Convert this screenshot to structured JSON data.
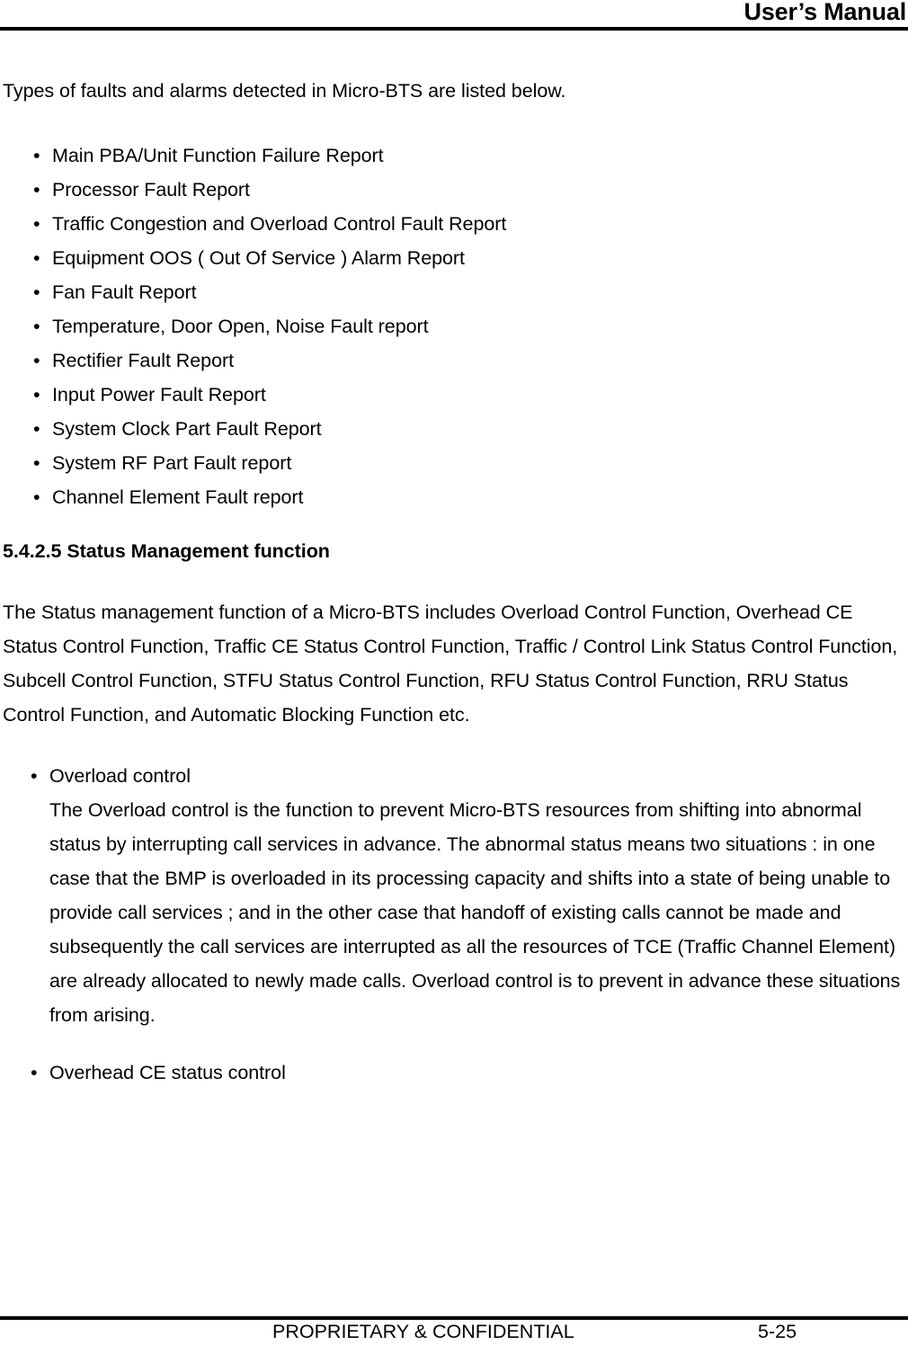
{
  "header": {
    "title": "User’s Manual"
  },
  "intro": {
    "paragraph": "Types of faults and alarms detected in Micro-BTS are listed below."
  },
  "fault_list": {
    "bullet_glyph": "•",
    "items": [
      "Main PBA/Unit Function Failure Report",
      "Processor Fault Report",
      "Traffic Congestion and Overload Control Fault Report",
      "Equipment OOS ( Out Of Service ) Alarm Report",
      "Fan Fault Report",
      "Temperature, Door Open, Noise Fault report",
      "Rectifier Fault Report",
      "Input Power Fault Report",
      "System Clock Part Fault Report",
      "System RF Part Fault report",
      "Channel Element Fault report"
    ]
  },
  "section": {
    "heading": "5.4.2.5 Status Management function",
    "intro_paragraph": "The Status management function of a Micro-BTS includes Overload Control Function, Overhead CE Status Control Function, Traffic CE Status Control Function, Traffic / Control Link Status Control Function, Subcell Control Function, STFU Status Control Function, RFU Status Control Function, RRU Status Control Function, and Automatic Blocking Function etc."
  },
  "function_list": {
    "bullet_glyph": "•",
    "items": [
      {
        "title": "Overload control",
        "body": "The Overload control is the function to prevent Micro-BTS resources from shifting into abnormal status by interrupting call services in advance. The abnormal status means two situations : in one case that the BMP is overloaded in its processing capacity and shifts into a state of being unable to provide call services ; and in the other case that handoff of existing calls cannot be made and subsequently the call services are interrupted as all the resources of TCE (Traffic Channel Element) are already allocated to newly made calls. Overload control is to prevent in advance these situations from arising."
      },
      {
        "title": "Overhead CE status control",
        "body": ""
      }
    ]
  },
  "footer": {
    "confidential": "PROPRIETARY & CONFIDENTIAL",
    "page_number": "5-25"
  }
}
